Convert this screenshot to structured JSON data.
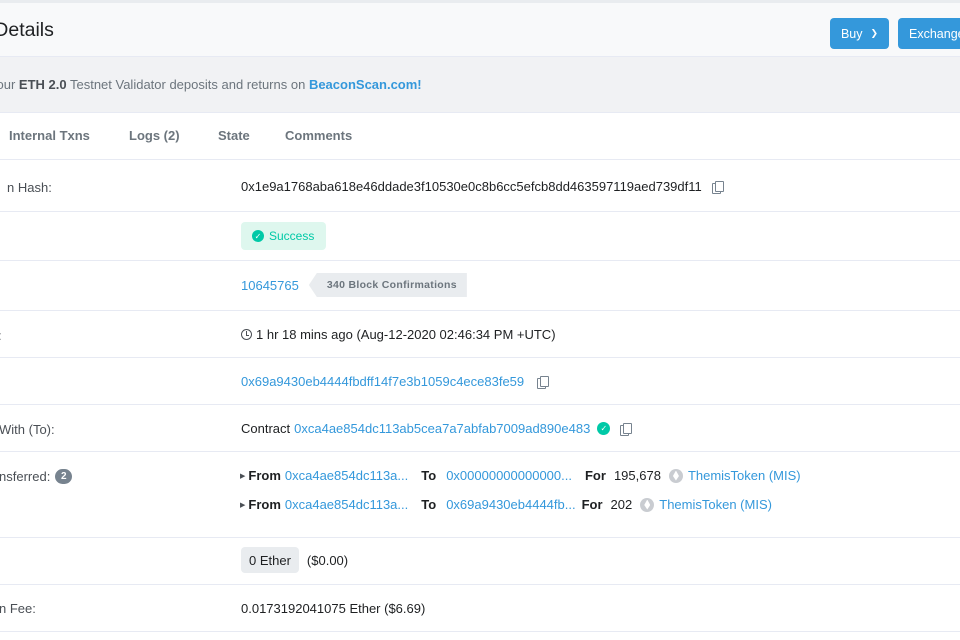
{
  "header": {
    "title": "n Details",
    "buy_label": "Buy",
    "exchange_label": "Exchange"
  },
  "banner": {
    "prefix": "your ",
    "bold": "ETH 2.0",
    "middle": " Testnet Validator deposits and returns on ",
    "link": "BeaconScan.com!"
  },
  "tabs": [
    {
      "label": "Internal Txns"
    },
    {
      "label": "Logs (2)"
    },
    {
      "label": "State"
    },
    {
      "label": "Comments"
    }
  ],
  "rows": {
    "hash": {
      "label": "n Hash:",
      "value": "0x1e9a1768aba618e46ddade3f10530e0c8b6cc5efcb8dd463597119aed739df11"
    },
    "status": {
      "value": "Success"
    },
    "block": {
      "number": "10645765",
      "confirmations": "340 Block Confirmations"
    },
    "timestamp": {
      "label": ":",
      "value": "1 hr 18 mins ago (Aug-12-2020 02:46:34 PM +UTC)"
    },
    "from": {
      "value": "0x69a9430eb4444fbdff14f7e3b1059c4ece83fe59"
    },
    "interacted": {
      "label": "With (To):",
      "prefix": "Contract",
      "value": "0xca4ae854dc113ab5cea7a7abfab7009ad890e483"
    },
    "tokens": {
      "label": "nsferred:",
      "count": "2",
      "transfers": [
        {
          "from_label": "From",
          "from": "0xca4ae854dc113a...",
          "to_label": "To",
          "to": "0x00000000000000...",
          "for_label": "For",
          "amount": "195,678",
          "token": "ThemisToken (MIS)"
        },
        {
          "from_label": "From",
          "from": "0xca4ae854dc113a...",
          "to_label": "To",
          "to": "0x69a9430eb4444fb...",
          "for_label": "For",
          "amount": "202",
          "token": "ThemisToken (MIS)"
        }
      ]
    },
    "value": {
      "ether": "0 Ether",
      "usd": "($0.00)"
    },
    "fee": {
      "label": "n Fee:",
      "value": "0.0173192041075 Ether ($6.69)"
    }
  },
  "colors": {
    "link": "#3498db",
    "success": "#00c9a7",
    "button": "#3498db"
  }
}
